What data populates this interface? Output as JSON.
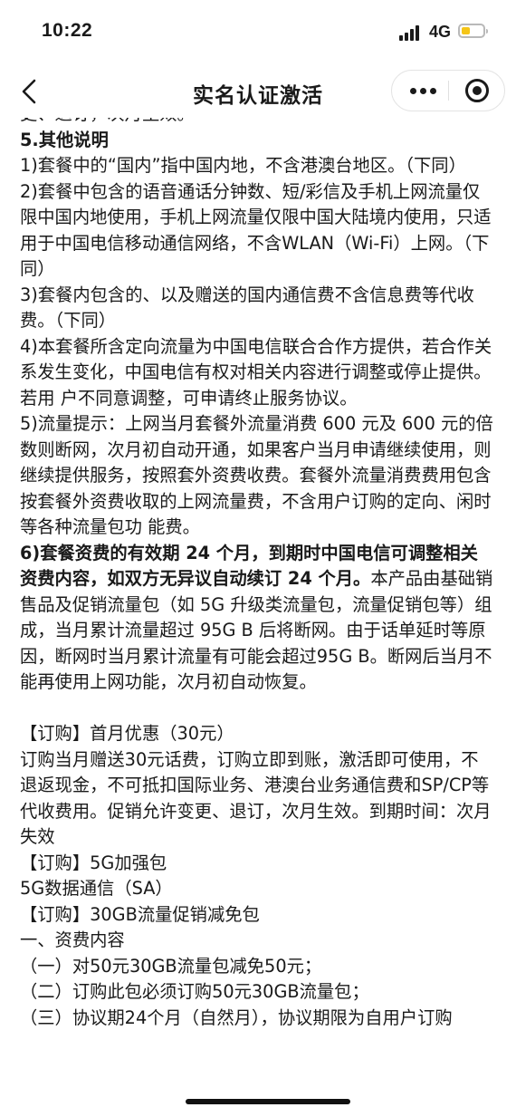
{
  "status_bar": {
    "time": "10:22",
    "network": "4G",
    "battery_level": 0.3
  },
  "nav": {
    "title": "实名认证激活"
  },
  "content": {
    "cut_top": "更、退订，次月生效。",
    "section_title": "5.其他说明",
    "p1": "1)套餐中的“国内”指中国内地，不含港澳台地区。（下同）",
    "p2": "2)套餐中包含的语音通话分钟数、短/彩信及手机上网流量仅限中国内地使用，手机上网流量仅限中国大陆境内使用，只适用于中国电信移动通信网络，不含WLAN（Wi-Fi）上网。（下同）",
    "p3": "3)套餐内包含的、以及赠送的国内通信费不含信息费等代收费。（下同）",
    "p4": "4)本套餐所含定向流量为中国电信联合合作方提供，若合作关系发生变化，中国电信有权对相关内容进行调整或停止提供。若用 户不同意调整，可申请终止服务协议。",
    "p5": "5)流量提示：上网当月套餐外流量消费 600 元及 600 元的倍数则断网，次月初自动开通，如果客户当月申请继续使用，则继续提供服务，按照套外资费收费。套餐外流量消费费用包含按套餐外资费收取的上网流量费，不含用户订购的定向、闲时等各种流量包功 能费。",
    "p6_bold": "6)套餐资费的有效期 24 个月，到期时中国电信可调整相关资费内容，如双方无异议自动续订 24 个月。",
    "p6_rest": "本产品由基础销售品及促销流量包（如 5G 升级类流量包，流量促销包等）组成，当月累计流量超过 95G B 后将断网。由于话单延时等原因，断网时当月累计流量有可能会超过95G B。断网后当月不能再使用上网功能，次月初自动恢复。",
    "order1_title": "【订购】首月优惠（30元）",
    "order1_desc": "订购当月赠送30元话费，订购立即到账，激活即可使用，不退返现金，不可抵扣国际业务、港澳台业务通信费和SP/CP等代收费用。促销允许变更、退订，次月生效。到期时间：次月失效",
    "order2_title": "【订购】5G加强包",
    "order2_desc": "5G数据通信（SA）",
    "order3_title": "【订购】30GB流量促销减免包",
    "tariff_heading": "一、资费内容",
    "item1": "（一）对50元30GB流量包减免50元；",
    "item2": "（二）订购此包必须订购50元30GB流量包；",
    "item3": "（三）协议期24个月（自然月），协议期限为自用户订购"
  }
}
